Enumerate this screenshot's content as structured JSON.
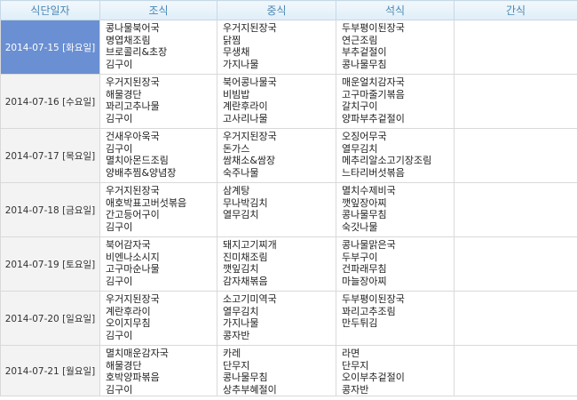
{
  "headers": {
    "date": "식단일자",
    "breakfast": "조식",
    "lunch": "중식",
    "dinner": "석식",
    "snack": "간식"
  },
  "rows": [
    {
      "date": "2014-07-15 [화요일]",
      "selected": true,
      "breakfast": [
        "콩나물북어국",
        "명엽채조림",
        "브로콜리&초장",
        "김구이"
      ],
      "lunch": [
        "우거지된장국",
        "닭찜",
        "무생채",
        "가지나물"
      ],
      "dinner": [
        "두부평이된장국",
        "연근조림",
        "부추겉절이",
        "콩나물무침"
      ],
      "snack": []
    },
    {
      "date": "2014-07-16 [수요일]",
      "selected": false,
      "breakfast": [
        "우거지된장국",
        "해물경단",
        "꽈리고추나물",
        "김구이"
      ],
      "lunch": [
        "북어콩나물국",
        "비빔밥",
        "계란후라이",
        "고사리나물"
      ],
      "dinner": [
        "매운얼치감자국",
        "고구마줄기볶음",
        "갈치구이",
        "양파부추겉절이"
      ],
      "snack": []
    },
    {
      "date": "2014-07-17 [목요일]",
      "selected": false,
      "breakfast": [
        "건새우아욱국",
        "김구이",
        "멸치아몬드조림",
        "양배추찜&양념장"
      ],
      "lunch": [
        "우거지된장국",
        "돈가스",
        "쌈채소&쌈장",
        "숙주나물"
      ],
      "dinner": [
        "오징어무국",
        "열무김치",
        "메추리알소고기장조림",
        "느타리버섯볶음"
      ],
      "snack": []
    },
    {
      "date": "2014-07-18 [금요일]",
      "selected": false,
      "breakfast": [
        "우거지된장국",
        "애호박표고버섯볶음",
        "간고등어구이",
        "김구이"
      ],
      "lunch": [
        "삼계탕",
        "무나박김치",
        "열무김치"
      ],
      "dinner": [
        "멸치수제비국",
        "깻잎장아찌",
        "콩나물무침",
        "숙갓나물"
      ],
      "snack": []
    },
    {
      "date": "2014-07-19 [토요일]",
      "selected": false,
      "breakfast": [
        "북어감자국",
        "비엔나소시지",
        "고구마순나물",
        "김구이"
      ],
      "lunch": [
        "돼지고기찌개",
        "진미채조림",
        "깻잎김치",
        "감자채볶음"
      ],
      "dinner": [
        "콩나물맑은국",
        "두부구이",
        "건파래무침",
        "마늘장아찌"
      ],
      "snack": []
    },
    {
      "date": "2014-07-20 [일요일]",
      "selected": false,
      "breakfast": [
        "우거지된장국",
        "계란후라이",
        "오이지무침",
        "김구이"
      ],
      "lunch": [
        "소고기미역국",
        "열무김치",
        "가지나물",
        "콩자반"
      ],
      "dinner": [
        "두부평이된장국",
        "꽈리고추조림",
        "만두튀김"
      ],
      "snack": []
    },
    {
      "date": "2014-07-21 [월요일]",
      "selected": false,
      "breakfast": [
        "멸치매운감자국",
        "해물경단",
        "호박양파볶음",
        "김구이"
      ],
      "lunch": [
        "카레",
        "단무지",
        "콩나물무침",
        "상추부혜절이"
      ],
      "dinner": [
        "라면",
        "단무지",
        "오이부추겉절이",
        "콩자반"
      ],
      "snack": []
    }
  ]
}
